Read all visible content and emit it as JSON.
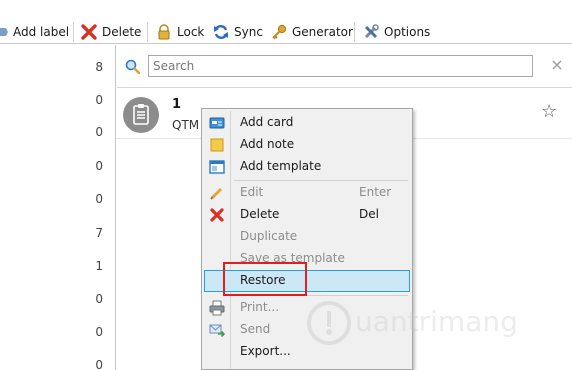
{
  "toolbar": {
    "items": [
      {
        "label": "Add label"
      },
      {
        "label": "Delete"
      },
      {
        "label": "Lock"
      },
      {
        "label": "Sync"
      },
      {
        "label": "Generator"
      },
      {
        "label": "Options"
      }
    ]
  },
  "label_counts": [
    "8",
    "0",
    "0",
    "0",
    "0",
    "7",
    "1",
    "0",
    "0",
    "0"
  ],
  "search": {
    "placeholder": "Search",
    "value": "",
    "clear": "×"
  },
  "card": {
    "title": "1",
    "subtitle": "QTM"
  },
  "context_menu": {
    "items": [
      {
        "label": "Add card",
        "shortcut": "",
        "enabled": true
      },
      {
        "label": "Add note",
        "shortcut": "",
        "enabled": true
      },
      {
        "label": "Add template",
        "shortcut": "",
        "enabled": true
      },
      {
        "label": "Edit",
        "shortcut": "Enter",
        "enabled": false
      },
      {
        "label": "Delete",
        "shortcut": "Del",
        "enabled": true
      },
      {
        "label": "Duplicate",
        "shortcut": "",
        "enabled": false
      },
      {
        "label": "Save as template",
        "shortcut": "",
        "enabled": false
      },
      {
        "label": "Restore",
        "shortcut": "",
        "enabled": true,
        "highlighted": true
      },
      {
        "label": "Print...",
        "shortcut": "",
        "enabled": false
      },
      {
        "label": "Send",
        "shortcut": "",
        "enabled": false
      },
      {
        "label": "Export...",
        "shortcut": "",
        "enabled": true
      }
    ]
  },
  "watermark": {
    "text": "uantrimang"
  },
  "colors": {
    "highlight": "#cce8f7",
    "highlight_border": "#26a0da",
    "annotation_box": "#e02020"
  }
}
